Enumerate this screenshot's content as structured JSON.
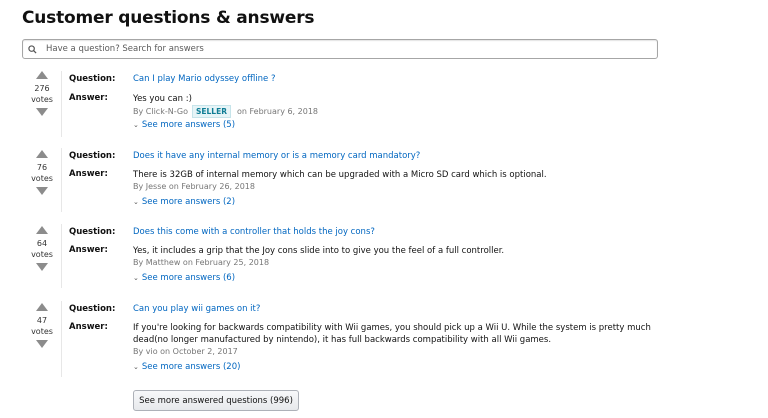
{
  "title": "Customer questions & answers",
  "search": {
    "placeholder": "Have a question? Search for answers"
  },
  "labels": {
    "question": "Question:",
    "answer": "Answer:",
    "votes": "votes"
  },
  "items": [
    {
      "votes": "276",
      "question": "Can I play Mario odyssey offline ?",
      "answer": "Yes you can :)",
      "by": "By Click-N-Go",
      "badge": "SELLER",
      "date": "on February 6, 2018",
      "more": "See more answers (5)"
    },
    {
      "votes": "76",
      "question": "Does it have any internal memory or is a memory card mandatory?",
      "answer": "There is 32GB of internal memory which can be upgraded with a Micro SD card which is optional.",
      "byline": "By Jesse on February 26, 2018",
      "more": "See more answers (2)"
    },
    {
      "votes": "64",
      "question": "Does this come with a controller that holds the joy cons?",
      "answer": "Yes, it includes a grip that the Joy cons slide into to give you the feel of a full controller.",
      "byline": "By Matthew on February 25, 2018",
      "more": "See more answers (6)"
    },
    {
      "votes": "47",
      "question": "Can you play wii games on it?",
      "answer_line1": "If you're looking for backwards compatibility with Wii games, you should pick up a Wii U. While the system is pretty much",
      "answer_line2": "dead(no longer manufactured by nintendo), it has full backwards compatibility with all Wii games.",
      "byline": "By vio on October 2, 2017",
      "more": "See more answers (20)"
    }
  ],
  "more_button": "See more answered questions (996)",
  "icons": {
    "chevron": "chevron-down-icon",
    "search": "search-icon",
    "vote_up": "upvote-arrow-icon",
    "vote_down": "downvote-arrow-icon"
  }
}
